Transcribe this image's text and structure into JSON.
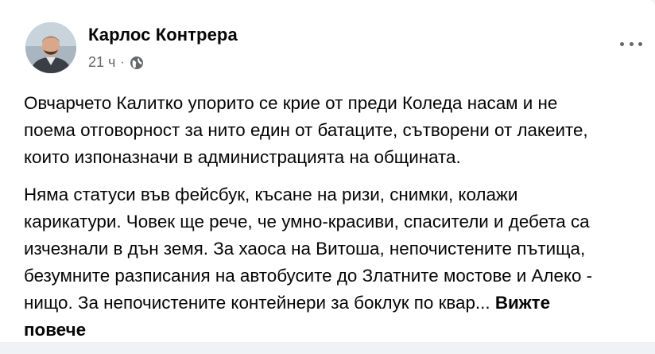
{
  "post": {
    "author": "Карлос Контрера",
    "time": "21 ч",
    "separator": "·",
    "privacy_icon": "globe-icon",
    "more_icon": "more-options-icon",
    "paragraph1": [
      "Овчарчето Калитко упорито се крие от преди Коледа насам и не",
      "поема отговорност за нито един от батаците, сътворени от лакеите,",
      "които изпоназначи в администрацията на общината."
    ],
    "paragraph2": [
      "Няма статуси във фейсбук, късане на ризи, снимки, колажи",
      "карикатури. Човек ще рече, че умно-красиви, спасители и дебета са",
      "изчезнали в дън земя. За хаоса на Витоша, непочистените пътища,",
      "безумните разписания на автобусите до Златните мостове и Алеко -",
      "нищо. За непочистените контейнери за боклук по квар..."
    ],
    "see_more_part1": "Вижте",
    "see_more_part2": "повече"
  },
  "colors": {
    "text": "#050505",
    "secondary": "#65676b",
    "background": "#ffffff",
    "page": "#f0f2f5"
  }
}
